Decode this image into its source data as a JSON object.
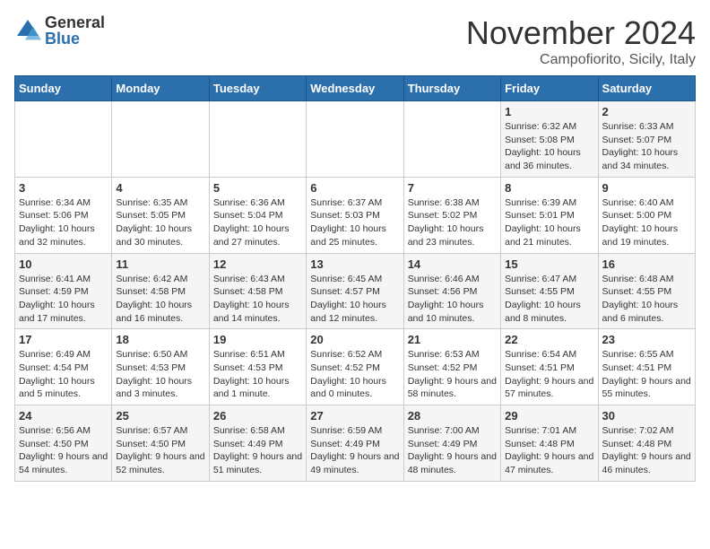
{
  "logo": {
    "general": "General",
    "blue": "Blue"
  },
  "title": {
    "month": "November 2024",
    "location": "Campofiorito, Sicily, Italy"
  },
  "weekdays": [
    "Sunday",
    "Monday",
    "Tuesday",
    "Wednesday",
    "Thursday",
    "Friday",
    "Saturday"
  ],
  "weeks": [
    [
      {
        "day": "",
        "info": ""
      },
      {
        "day": "",
        "info": ""
      },
      {
        "day": "",
        "info": ""
      },
      {
        "day": "",
        "info": ""
      },
      {
        "day": "",
        "info": ""
      },
      {
        "day": "1",
        "info": "Sunrise: 6:32 AM\nSunset: 5:08 PM\nDaylight: 10 hours and 36 minutes."
      },
      {
        "day": "2",
        "info": "Sunrise: 6:33 AM\nSunset: 5:07 PM\nDaylight: 10 hours and 34 minutes."
      }
    ],
    [
      {
        "day": "3",
        "info": "Sunrise: 6:34 AM\nSunset: 5:06 PM\nDaylight: 10 hours and 32 minutes."
      },
      {
        "day": "4",
        "info": "Sunrise: 6:35 AM\nSunset: 5:05 PM\nDaylight: 10 hours and 30 minutes."
      },
      {
        "day": "5",
        "info": "Sunrise: 6:36 AM\nSunset: 5:04 PM\nDaylight: 10 hours and 27 minutes."
      },
      {
        "day": "6",
        "info": "Sunrise: 6:37 AM\nSunset: 5:03 PM\nDaylight: 10 hours and 25 minutes."
      },
      {
        "day": "7",
        "info": "Sunrise: 6:38 AM\nSunset: 5:02 PM\nDaylight: 10 hours and 23 minutes."
      },
      {
        "day": "8",
        "info": "Sunrise: 6:39 AM\nSunset: 5:01 PM\nDaylight: 10 hours and 21 minutes."
      },
      {
        "day": "9",
        "info": "Sunrise: 6:40 AM\nSunset: 5:00 PM\nDaylight: 10 hours and 19 minutes."
      }
    ],
    [
      {
        "day": "10",
        "info": "Sunrise: 6:41 AM\nSunset: 4:59 PM\nDaylight: 10 hours and 17 minutes."
      },
      {
        "day": "11",
        "info": "Sunrise: 6:42 AM\nSunset: 4:58 PM\nDaylight: 10 hours and 16 minutes."
      },
      {
        "day": "12",
        "info": "Sunrise: 6:43 AM\nSunset: 4:58 PM\nDaylight: 10 hours and 14 minutes."
      },
      {
        "day": "13",
        "info": "Sunrise: 6:45 AM\nSunset: 4:57 PM\nDaylight: 10 hours and 12 minutes."
      },
      {
        "day": "14",
        "info": "Sunrise: 6:46 AM\nSunset: 4:56 PM\nDaylight: 10 hours and 10 minutes."
      },
      {
        "day": "15",
        "info": "Sunrise: 6:47 AM\nSunset: 4:55 PM\nDaylight: 10 hours and 8 minutes."
      },
      {
        "day": "16",
        "info": "Sunrise: 6:48 AM\nSunset: 4:55 PM\nDaylight: 10 hours and 6 minutes."
      }
    ],
    [
      {
        "day": "17",
        "info": "Sunrise: 6:49 AM\nSunset: 4:54 PM\nDaylight: 10 hours and 5 minutes."
      },
      {
        "day": "18",
        "info": "Sunrise: 6:50 AM\nSunset: 4:53 PM\nDaylight: 10 hours and 3 minutes."
      },
      {
        "day": "19",
        "info": "Sunrise: 6:51 AM\nSunset: 4:53 PM\nDaylight: 10 hours and 1 minute."
      },
      {
        "day": "20",
        "info": "Sunrise: 6:52 AM\nSunset: 4:52 PM\nDaylight: 10 hours and 0 minutes."
      },
      {
        "day": "21",
        "info": "Sunrise: 6:53 AM\nSunset: 4:52 PM\nDaylight: 9 hours and 58 minutes."
      },
      {
        "day": "22",
        "info": "Sunrise: 6:54 AM\nSunset: 4:51 PM\nDaylight: 9 hours and 57 minutes."
      },
      {
        "day": "23",
        "info": "Sunrise: 6:55 AM\nSunset: 4:51 PM\nDaylight: 9 hours and 55 minutes."
      }
    ],
    [
      {
        "day": "24",
        "info": "Sunrise: 6:56 AM\nSunset: 4:50 PM\nDaylight: 9 hours and 54 minutes."
      },
      {
        "day": "25",
        "info": "Sunrise: 6:57 AM\nSunset: 4:50 PM\nDaylight: 9 hours and 52 minutes."
      },
      {
        "day": "26",
        "info": "Sunrise: 6:58 AM\nSunset: 4:49 PM\nDaylight: 9 hours and 51 minutes."
      },
      {
        "day": "27",
        "info": "Sunrise: 6:59 AM\nSunset: 4:49 PM\nDaylight: 9 hours and 49 minutes."
      },
      {
        "day": "28",
        "info": "Sunrise: 7:00 AM\nSunset: 4:49 PM\nDaylight: 9 hours and 48 minutes."
      },
      {
        "day": "29",
        "info": "Sunrise: 7:01 AM\nSunset: 4:48 PM\nDaylight: 9 hours and 47 minutes."
      },
      {
        "day": "30",
        "info": "Sunrise: 7:02 AM\nSunset: 4:48 PM\nDaylight: 9 hours and 46 minutes."
      }
    ]
  ]
}
